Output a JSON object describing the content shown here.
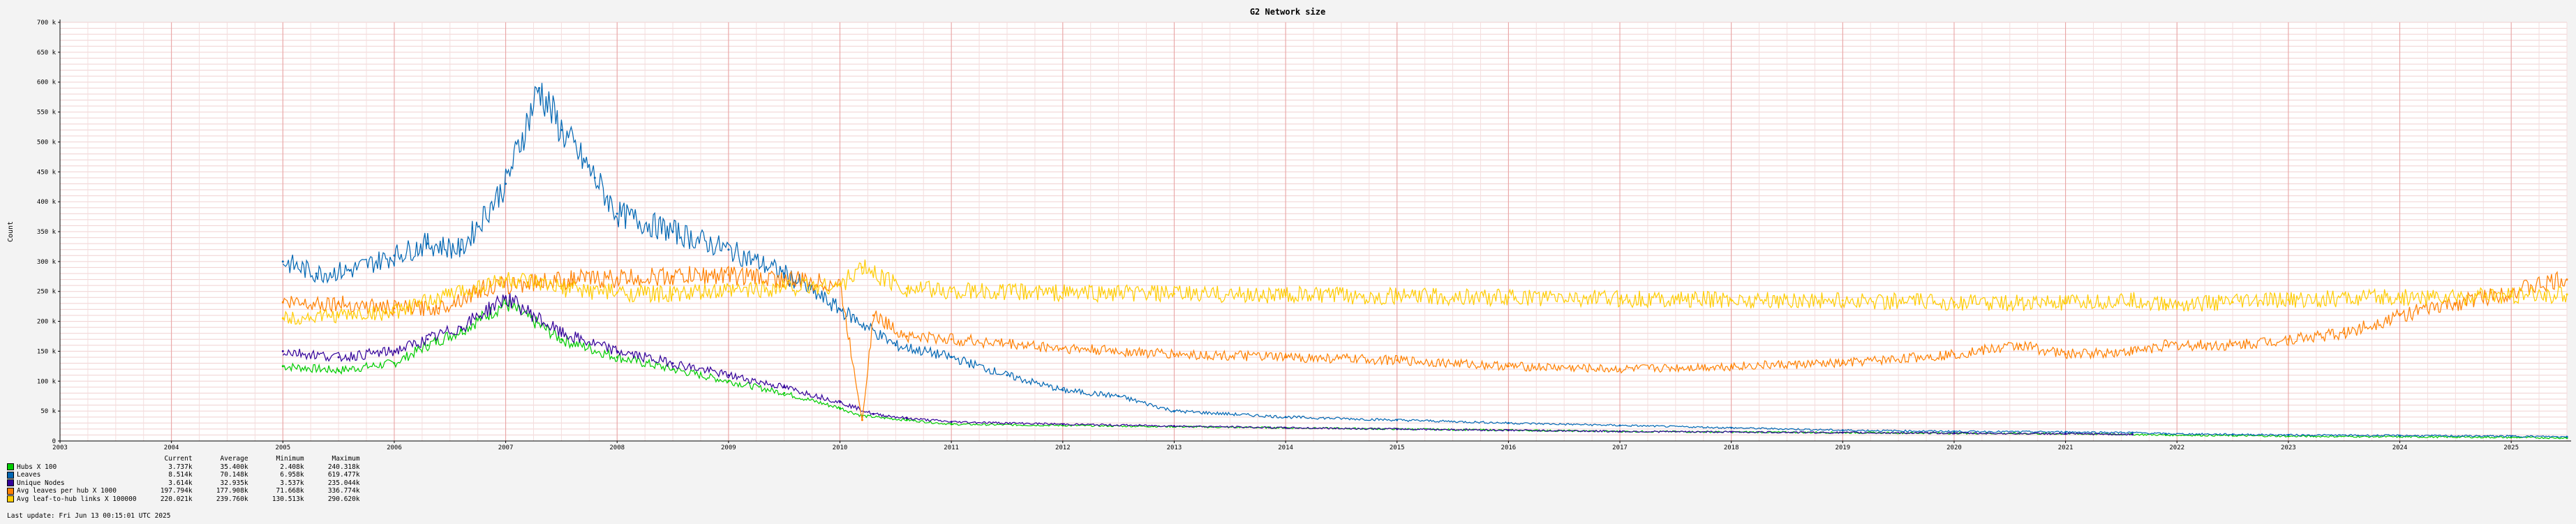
{
  "chart_data": {
    "type": "line",
    "title": "G2 Network size",
    "ylabel": "Count",
    "ylim": [
      0,
      700000
    ],
    "yticks": [
      {
        "value": 0,
        "label": "0"
      },
      {
        "value": 50000,
        "label": "50 k"
      },
      {
        "value": 100000,
        "label": "100 k"
      },
      {
        "value": 150000,
        "label": "150 k"
      },
      {
        "value": 200000,
        "label": "200 k"
      },
      {
        "value": 250000,
        "label": "250 k"
      },
      {
        "value": 300000,
        "label": "300 k"
      },
      {
        "value": 350000,
        "label": "350 k"
      },
      {
        "value": 400000,
        "label": "400 k"
      },
      {
        "value": 450000,
        "label": "450 k"
      },
      {
        "value": 500000,
        "label": "500 k"
      },
      {
        "value": 550000,
        "label": "550 k"
      },
      {
        "value": 600000,
        "label": "600 k"
      },
      {
        "value": 650000,
        "label": "650 k"
      },
      {
        "value": 700000,
        "label": "700 k"
      }
    ],
    "xlim": [
      2003,
      2025.5
    ],
    "xticks": [
      2003,
      2004,
      2005,
      2006,
      2007,
      2008,
      2009,
      2010,
      2011,
      2012,
      2013,
      2014,
      2015,
      2016,
      2017,
      2018,
      2019,
      2020,
      2021,
      2022,
      2023,
      2024,
      2025
    ],
    "grid": true,
    "series": [
      {
        "name": "Hubs X 100",
        "color": "#00cc00",
        "x": [
          2005.0,
          2005.5,
          2006.0,
          2006.3,
          2006.6,
          2007.0,
          2007.5,
          2008.0,
          2008.5,
          2009.0,
          2009.5,
          2010.0,
          2010.2,
          2010.6,
          2011,
          2012,
          2013,
          2014,
          2015,
          2016,
          2017,
          2018,
          2019,
          2020,
          2021,
          2021.6,
          2021.9,
          2022.5,
          2023,
          2024,
          2025,
          2025.5
        ],
        "y": [
          125000,
          118000,
          130000,
          160000,
          185000,
          230000,
          170000,
          140000,
          120000,
          100000,
          80000,
          55000,
          42000,
          35000,
          28000,
          26000,
          24000,
          22000,
          20000,
          18000,
          16000,
          15000,
          14000,
          13000,
          12000,
          11000,
          10000,
          9000,
          8000,
          7000,
          6000,
          5000
        ]
      },
      {
        "name": "Leaves",
        "color": "#0066b3",
        "x": [
          2005.0,
          2005.3,
          2005.6,
          2006.0,
          2006.3,
          2006.6,
          2007.0,
          2007.3,
          2007.5,
          2007.8,
          2008.0,
          2008.5,
          2009.0,
          2009.5,
          2010.0,
          2010.5,
          2011.0,
          2011.5,
          2012.0,
          2012.5,
          2013,
          2014,
          2015,
          2016,
          2017,
          2018,
          2019,
          2020,
          2021,
          2021.6,
          2021.9,
          2022.5,
          2023,
          2024,
          2025,
          2025.5
        ],
        "y": [
          300000,
          280000,
          285000,
          310000,
          330000,
          320000,
          430000,
          590000,
          520000,
          440000,
          380000,
          350000,
          320000,
          280000,
          220000,
          160000,
          140000,
          110000,
          85000,
          75000,
          50000,
          40000,
          35000,
          30000,
          26000,
          22000,
          18000,
          16000,
          15000,
          14000,
          12000,
          11000,
          10000,
          9000,
          8000,
          7000
        ]
      },
      {
        "name": "Unique Nodes",
        "color": "#330099",
        "x": [
          2005.0,
          2005.5,
          2006.0,
          2006.3,
          2006.6,
          2007.0,
          2007.5,
          2008.0,
          2008.5,
          2009.0,
          2009.5,
          2010.0,
          2010.3,
          2010.6,
          2011,
          2012,
          2013,
          2014,
          2015,
          2016,
          2017,
          2018,
          2019,
          2020,
          2021,
          2021.6
        ],
        "y": [
          150000,
          140000,
          150000,
          170000,
          190000,
          240000,
          180000,
          150000,
          130000,
          110000,
          90000,
          65000,
          45000,
          38000,
          32000,
          28000,
          25000,
          22000,
          20000,
          18000,
          16000,
          15000,
          14000,
          13000,
          12000,
          11000
        ]
      },
      {
        "name": "Avg leaves per hub X 1000",
        "color": "#ff8000",
        "x": [
          2005.0,
          2005.5,
          2006.0,
          2006.4,
          2006.8,
          2007.2,
          2007.6,
          2008.0,
          2008.5,
          2009.0,
          2009.5,
          2010.0,
          2010.2,
          2010.3,
          2010.6,
          2011,
          2012,
          2013,
          2014,
          2015,
          2016,
          2017,
          2018,
          2019,
          2020,
          2020.6,
          2021,
          2021.6,
          2021.9,
          2022.5,
          2023,
          2023.5,
          2024,
          2024.5,
          2025,
          2025.5
        ],
        "y": [
          232000,
          230000,
          222000,
          222000,
          255000,
          265000,
          270000,
          272000,
          275000,
          278000,
          270000,
          262000,
          35000,
          210000,
          175000,
          170000,
          155000,
          145000,
          140000,
          135000,
          125000,
          120000,
          125000,
          130000,
          145000,
          160000,
          145000,
          150000,
          160000,
          160000,
          170000,
          180000,
          210000,
          230000,
          250000,
          270000
        ]
      },
      {
        "name": "Avg leaf-to-hub links X 100000",
        "color": "#ffcc00",
        "x": [
          2005.0,
          2005.5,
          2006.0,
          2006.5,
          2007.0,
          2007.5,
          2008.0,
          2008.5,
          2009.0,
          2009.5,
          2010.0,
          2010.2,
          2010.6,
          2011,
          2012,
          2013,
          2014,
          2015,
          2016,
          2017,
          2018,
          2019,
          2020,
          2021,
          2021.6,
          2021.9,
          2022.5,
          2023,
          2024,
          2025,
          2025.5
        ],
        "y": [
          205000,
          210000,
          215000,
          245000,
          270000,
          255000,
          248000,
          245000,
          250000,
          258000,
          260000,
          290000,
          255000,
          250000,
          248000,
          246000,
          244000,
          242000,
          240000,
          238000,
          236000,
          235000,
          232000,
          230000,
          235000,
          228000,
          232000,
          236000,
          240000,
          242000,
          245000
        ]
      }
    ],
    "legend_stats_header": {
      "current": "Current",
      "average": "Average",
      "minimum": "Minimum",
      "maximum": "Maximum"
    },
    "legend_stats": [
      {
        "name": "Hubs X 100",
        "current": "3.737k",
        "average": "35.400k",
        "minimum": "2.408k",
        "maximum": "240.318k"
      },
      {
        "name": "Leaves",
        "current": "8.514k",
        "average": "70.148k",
        "minimum": "6.958k",
        "maximum": "619.477k"
      },
      {
        "name": "Unique Nodes",
        "current": "3.614k",
        "average": "32.935k",
        "minimum": "3.537k",
        "maximum": "235.044k"
      },
      {
        "name": "Avg leaves per hub X 1000",
        "current": "197.794k",
        "average": "177.908k",
        "minimum": "71.668k",
        "maximum": "336.774k"
      },
      {
        "name": "Avg leaf-to-hub links X 100000",
        "current": "220.021k",
        "average": "239.760k",
        "minimum": "130.513k",
        "maximum": "290.620k"
      }
    ],
    "last_update": "Last update: Fri Jun 13 00:15:01 UTC 2025"
  }
}
